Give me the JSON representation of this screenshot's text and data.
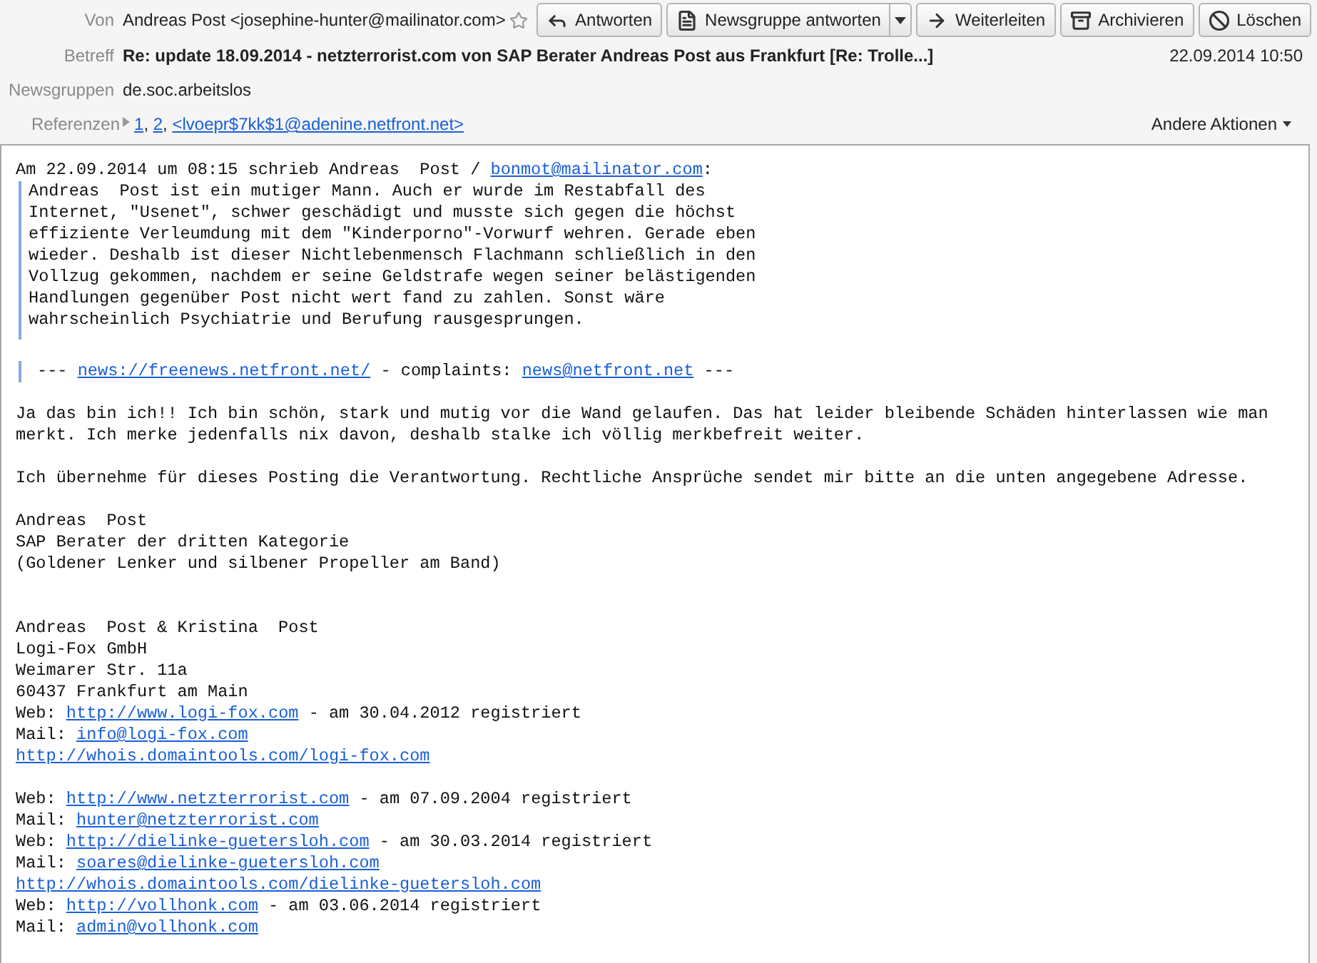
{
  "header": {
    "from_label": "Von",
    "from": "Andreas Post <josephine-hunter@mailinator.com>",
    "starred": false,
    "subject_label": "Betreff",
    "subject": "Re: update 18.09.2014 - netzterrorist.com von SAP Berater Andreas Post aus Frankfurt [Re: Trolle...]",
    "date": "22.09.2014 10:50",
    "newsgroups_label": "Newsgruppen",
    "newsgroups": "de.soc.arbeitslos",
    "references_label": "Referenzen",
    "references": [
      {
        "text": "1",
        "kind": "link"
      },
      {
        "text": ", ",
        "kind": "text"
      },
      {
        "text": "2",
        "kind": "link"
      },
      {
        "text": ", ",
        "kind": "text"
      },
      {
        "text": "<lvoepr$7kk$1@adenine.netfront.net>",
        "kind": "link"
      }
    ],
    "other_actions": "Andere Aktionen"
  },
  "buttons": [
    {
      "label": "Antworten",
      "kind": "reply",
      "split": false
    },
    {
      "label": "Newsgruppe antworten",
      "kind": "newsgroup",
      "split": true
    },
    {
      "label": "Weiterleiten",
      "kind": "forward",
      "split": false
    },
    {
      "label": "Archivieren",
      "kind": "archive",
      "split": false
    },
    {
      "label": "Löschen",
      "kind": "delete",
      "split": false
    }
  ],
  "body": [
    {
      "kind": "intro",
      "lines": [
        [
          {
            "text": "Am 22.09.2014 um 08:15 schrieb Andreas  Post / ",
            "kind": "text"
          },
          {
            "text": "bonmot@mailinator.com",
            "kind": "link"
          },
          {
            "text": ":",
            "kind": "text"
          }
        ]
      ]
    },
    {
      "kind": "quote",
      "lines": [
        [
          {
            "text": "Andreas  Post ist ein mutiger Mann. Auch er wurde im Restabfall des",
            "kind": "text"
          }
        ],
        [
          {
            "text": "Internet, \"Usenet\", schwer geschädigt und musste sich gegen die höchst",
            "kind": "text"
          }
        ],
        [
          {
            "text": "effiziente Verleumdung mit dem \"Kinderporno\"-Vorwurf wehren. Gerade eben",
            "kind": "text"
          }
        ],
        [
          {
            "text": "wieder. Deshalb ist dieser Nichtlebenmensch Flachmann schließlich in den",
            "kind": "text"
          }
        ],
        [
          {
            "text": "Vollzug gekommen, nachdem er seine Geldstrafe wegen seiner belästigenden",
            "kind": "text"
          }
        ],
        [
          {
            "text": "Handlungen gegenüber Post nicht wert fand zu zahlen. Sonst wäre",
            "kind": "text"
          }
        ],
        [
          {
            "text": "wahrscheinlich Psychiatrie und Berufung rausgesprungen.",
            "kind": "text"
          }
        ]
      ]
    },
    {
      "kind": "sig",
      "lines": [
        [
          {
            "text": "--- ",
            "kind": "text"
          },
          {
            "text": "news://freenews.netfront.net/",
            "kind": "link"
          },
          {
            "text": " - complaints: ",
            "kind": "text"
          },
          {
            "text": "news@netfront.net",
            "kind": "link"
          },
          {
            "text": " ---",
            "kind": "text"
          }
        ]
      ]
    },
    {
      "kind": "plain",
      "lines": [
        [
          {
            "text": "Ja das bin ich!! Ich bin schön, stark und mutig vor die Wand gelaufen. Das hat leider bleibende Schäden hinterlassen wie man",
            "kind": "text"
          }
        ],
        [
          {
            "text": "merkt. Ich merke jedenfalls nix davon, deshalb stalke ich völlig merkbefreit weiter.",
            "kind": "text"
          }
        ]
      ]
    },
    {
      "kind": "plain",
      "lines": [
        [
          {
            "text": "Ich übernehme für dieses Posting die Verantwortung. Rechtliche Ansprüche sendet mir bitte an die unten angegebene Adresse.",
            "kind": "text"
          }
        ]
      ]
    },
    {
      "kind": "plain",
      "lines": [
        [
          {
            "text": "Andreas  Post",
            "kind": "text"
          }
        ],
        [
          {
            "text": "SAP Berater der dritten Kategorie",
            "kind": "text"
          }
        ],
        [
          {
            "text": "(Goldener Lenker und silbener Propeller am Band)",
            "kind": "text"
          }
        ]
      ]
    },
    {
      "kind": "address",
      "lines": [
        [
          {
            "text": "Andreas  Post & Kristina  Post",
            "kind": "text"
          }
        ],
        [
          {
            "text": "Logi-Fox GmbH",
            "kind": "text"
          }
        ],
        [
          {
            "text": "Weimarer Str. 11a",
            "kind": "text"
          }
        ],
        [
          {
            "text": "60437 Frankfurt am Main",
            "kind": "text"
          }
        ],
        [
          {
            "text": "Web: ",
            "kind": "text"
          },
          {
            "text": "http://www.logi-fox.com",
            "kind": "link"
          },
          {
            "text": " - am 30.04.2012 registriert",
            "kind": "text"
          }
        ],
        [
          {
            "text": "Mail: ",
            "kind": "text"
          },
          {
            "text": "info@logi-fox.com",
            "kind": "link"
          }
        ],
        [
          {
            "text": "http://whois.domaintools.com/logi-fox.com",
            "kind": "link"
          }
        ]
      ]
    },
    {
      "kind": "plain",
      "lines": [
        [
          {
            "text": "Web: ",
            "kind": "text"
          },
          {
            "text": "http://www.netzterrorist.com",
            "kind": "link"
          },
          {
            "text": " - am 07.09.2004 registriert",
            "kind": "text"
          }
        ],
        [
          {
            "text": "Mail: ",
            "kind": "text"
          },
          {
            "text": "hunter@netzterrorist.com",
            "kind": "link"
          }
        ],
        [
          {
            "text": "Web: ",
            "kind": "text"
          },
          {
            "text": "http://dielinke-guetersloh.com",
            "kind": "link"
          },
          {
            "text": " - am 30.03.2014 registriert",
            "kind": "text"
          }
        ],
        [
          {
            "text": "Mail: ",
            "kind": "text"
          },
          {
            "text": "soares@dielinke-guetersloh.com",
            "kind": "link"
          }
        ],
        [
          {
            "text": "http://whois.domaintools.com/dielinke-guetersloh.com",
            "kind": "link"
          }
        ],
        [
          {
            "text": "Web: ",
            "kind": "text"
          },
          {
            "text": "http://vollhonk.com",
            "kind": "link"
          },
          {
            "text": " - am 03.06.2014 registriert",
            "kind": "text"
          }
        ],
        [
          {
            "text": "Mail: ",
            "kind": "text"
          },
          {
            "text": "admin@vollhonk.com",
            "kind": "link"
          }
        ]
      ]
    }
  ]
}
